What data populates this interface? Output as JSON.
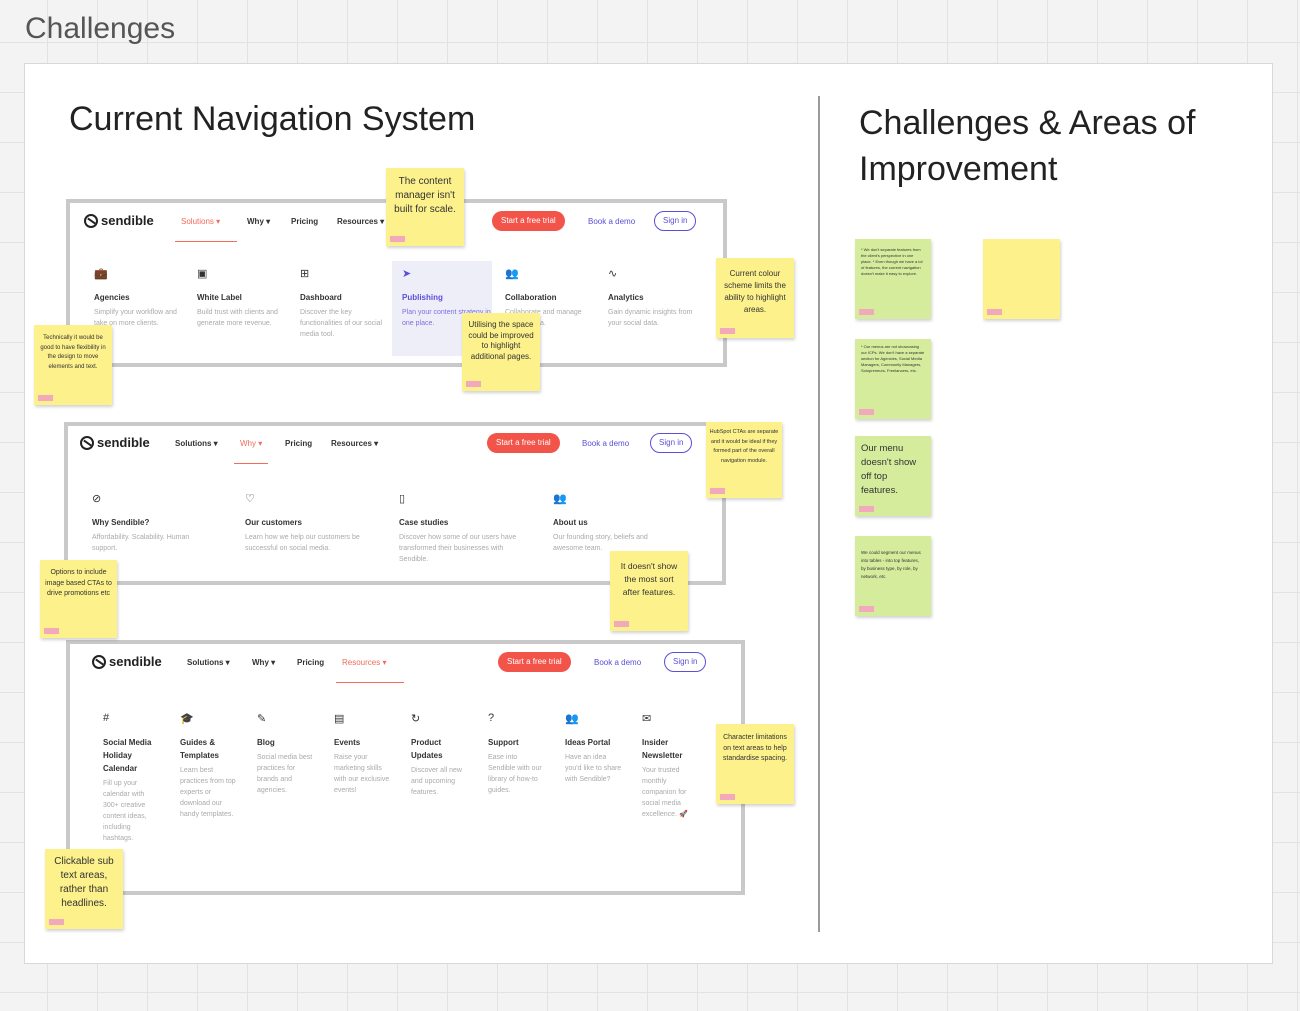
{
  "frame": {
    "title": "Challenges"
  },
  "left": {
    "heading": "Current Navigation System"
  },
  "right": {
    "heading": "Challenges & Areas of Improvement"
  },
  "screens": [
    {
      "logo": "sendible",
      "nav": [
        "Solutions ▾",
        "Why ▾",
        "Pricing",
        "Resources ▾"
      ],
      "cta_trial": "Start a free trial",
      "cta_demo": "Book a demo",
      "cta_sign": "Sign in",
      "items": [
        {
          "icon": "briefcase-icon",
          "title": "Agencies",
          "desc": "Simplify your workflow and take on more clients."
        },
        {
          "icon": "white-label-icon",
          "title": "White Label",
          "desc": "Build trust with clients and generate more revenue."
        },
        {
          "icon": "dashboard-icon",
          "title": "Dashboard",
          "desc": "Discover the key functionalities of our social media tool."
        },
        {
          "icon": "send-icon",
          "title": "Publishing",
          "desc": "Plan your content strategy in one place."
        },
        {
          "icon": "users-icon",
          "title": "Collaboration",
          "desc": "Collaborate and manage social media."
        },
        {
          "icon": "analytics-icon",
          "title": "Analytics",
          "desc": "Gain dynamic insights from your social data."
        }
      ]
    },
    {
      "logo": "sendible",
      "nav": [
        "Solutions ▾",
        "Why ▾",
        "Pricing",
        "Resources ▾"
      ],
      "cta_trial": "Start a free trial",
      "cta_demo": "Book a demo",
      "cta_sign": "Sign in",
      "items": [
        {
          "icon": "sendible-icon",
          "title": "Why Sendible?",
          "desc": "Affordability. Scalability. Human support."
        },
        {
          "icon": "heart-icon",
          "title": "Our customers",
          "desc": "Learn how we help our customers be successful on social media."
        },
        {
          "icon": "book-icon",
          "title": "Case studies",
          "desc": "Discover how some of our users have transformed their businesses with Sendible."
        },
        {
          "icon": "team-icon",
          "title": "About us",
          "desc": "Our founding story, beliefs and awesome team."
        }
      ]
    },
    {
      "logo": "sendible",
      "nav": [
        "Solutions ▾",
        "Why ▾",
        "Pricing",
        "Resources ▾"
      ],
      "cta_trial": "Start a free trial",
      "cta_demo": "Book a demo",
      "cta_sign": "Sign in",
      "items": [
        {
          "icon": "hash-icon",
          "title": "Social Media Holiday Calendar",
          "desc": "Fill up your calendar with 300+ creative content ideas, including hashtags."
        },
        {
          "icon": "graduation-cap-icon",
          "title": "Guides & Templates",
          "desc": "Learn best practices from top experts or download our handy templates."
        },
        {
          "icon": "blog-icon",
          "title": "Blog",
          "desc": "Social media best practices for brands and agencies."
        },
        {
          "icon": "events-icon",
          "title": "Events",
          "desc": "Raise your marketing skills with our exclusive events!"
        },
        {
          "icon": "refresh-icon",
          "title": "Product Updates",
          "desc": "Discover all new and upcoming features."
        },
        {
          "icon": "help-icon",
          "title": "Support",
          "desc": "Ease into Sendible with our library of how-to guides."
        },
        {
          "icon": "ideas-icon",
          "title": "Ideas Portal",
          "desc": "Have an idea you'd like to share with Sendible?"
        },
        {
          "icon": "mail-icon",
          "title": "Insider Newsletter",
          "desc": "Your trusted monthly companion for social media excellence. 🚀"
        }
      ]
    }
  ],
  "notes": {
    "content_manager": "The content manager isn't built for scale.",
    "colour_scheme": "Current colour scheme limits the ability to highlight areas.",
    "flexibility": "Technically it would be good to have flexibility in the design to move elements and text.",
    "space": "Utilising the space could be improved to highlight additional pages.",
    "hubspot": "HubSpot CTAs are separate and it would be ideal if they formed part of the overall navigation module.",
    "image_ctas": "Options to include image based CTAs to drive promotions etc",
    "sort": "It doesn't show the most sort after features.",
    "character": "Character limitations on text areas to help standardise spacing.",
    "clickable": "Clickable sub text areas, rather than headlines."
  },
  "challenges": [
    "* We don't separate features from the client's perspective in one place. * Even though we have a lot of features, the current navigation doesn't make it easy to explore.",
    "* Our menus are not showcasing our ICPs. We don't have a separate section for Agencies, Social Media Managers, Community Managers, Solopreneurs, Freelancers, etc.",
    "Our menu doesn't show off top features.",
    "We could segment our menus into tables - into top features, by business type, by role, by network, etc."
  ],
  "empty_note": ""
}
